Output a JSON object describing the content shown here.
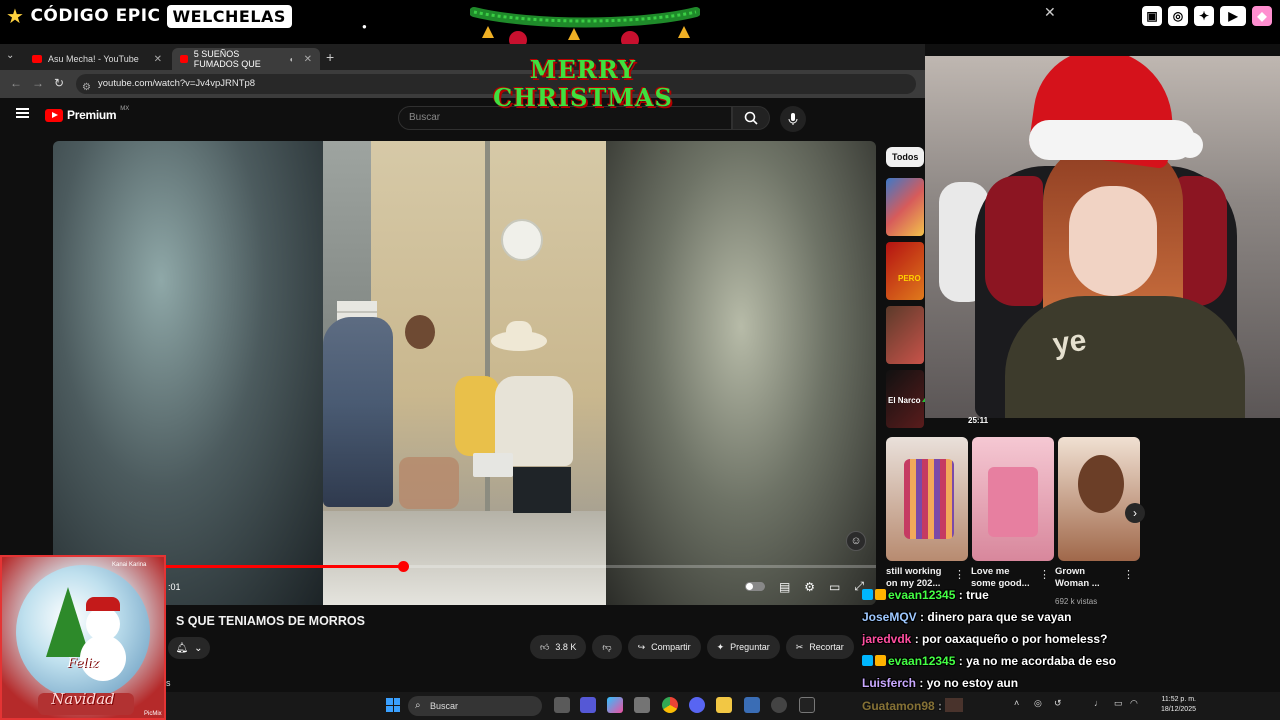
{
  "overlay": {
    "sponsor_code": "CÓDIGO EPIC",
    "sponsor_name": "WELCHELAS",
    "greeting_line1": "MERRY",
    "greeting_line2": "CHRISTMAS",
    "socials": [
      "twitch-icon",
      "instagram-icon",
      "twitter-icon",
      "youtube-icon",
      "gem-icon"
    ]
  },
  "browser": {
    "tabs": [
      {
        "label": "Asu Mecha! - YouTube",
        "active": false
      },
      {
        "label": "5 SUEÑOS FUMADOS QUE",
        "active": true
      }
    ],
    "url": "youtube.com/watch?v=Jv4vpJRNTp8"
  },
  "youtube": {
    "logo_word": "Premium",
    "region": "MX",
    "search_placeholder": "Buscar",
    "player": {
      "progress": 0.425,
      "time": ":01"
    },
    "video_title": "S QUE TENIAMOS DE MORROS",
    "likes": "3.8 K",
    "actions": {
      "share": "Compartir",
      "ask": "Preguntar",
      "clip": "Recortar"
    },
    "chip": "Todos",
    "thumb_tags": [
      "PERO",
      "El Narco"
    ],
    "shorts": [
      {
        "title_line1": "still working",
        "title_line2": "on my 202..."
      },
      {
        "title_line1": "Love me",
        "title_line2": "some good..."
      },
      {
        "title_line1": "Grown",
        "title_line2": "Woman ..."
      }
    ],
    "views": "692 k vistas",
    "small_s": "s"
  },
  "webcam": {
    "hoodie_text": "ye",
    "duration": "25:11"
  },
  "chat": [
    {
      "user": "evaan12345",
      "msg": "true",
      "color": "#44ff44",
      "badges": [
        "#00b7ff",
        "#ffb300"
      ]
    },
    {
      "user": "JoseMQV",
      "msg": "dinero para que se vayan",
      "color": "#9ec8ff",
      "badges": []
    },
    {
      "user": "jaredvdk",
      "msg": "por oaxaqueño o por homeless?",
      "color": "#ff4fa0",
      "badges": []
    },
    {
      "user": "evaan12345",
      "msg": "ya no me acordaba de eso",
      "color": "#44ff44",
      "badges": [
        "#00b7ff",
        "#ffb300"
      ]
    },
    {
      "user": "Luisferch",
      "msg": "yo no estoy aun",
      "color": "#c9a8ff",
      "badges": []
    },
    {
      "user": "Guatamon98",
      "msg": "",
      "color": "#ffd24d",
      "badges": []
    }
  ],
  "card": {
    "line1": "Feliz",
    "line2": "Navidad",
    "small": "Kanai Karina",
    "pm": "PicMix"
  },
  "taskbar": {
    "search": "Buscar",
    "time": "11:52 p. m.",
    "date": "18/12/2025"
  }
}
